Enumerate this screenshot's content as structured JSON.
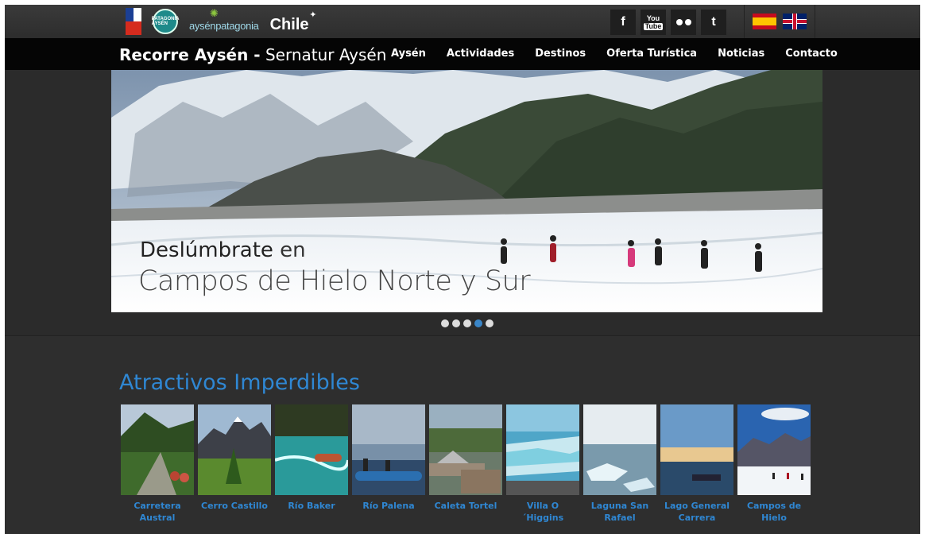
{
  "header": {
    "logos": {
      "gobierno": "",
      "patagonia_badge": "PATAGONIA AYSÉN",
      "aysen_patagonia": "aysénpatagonia",
      "chile": "Chile"
    },
    "social": {
      "facebook": "f",
      "youtube_top": "You",
      "youtube_bottom": "Tube",
      "twitter": "t"
    }
  },
  "nav": {
    "brand_bold": "Recorre Aysén -",
    "brand_light": " Sernatur Aysén",
    "items": [
      "Aysén",
      "Actividades",
      "Destinos",
      "Oferta Turística",
      "Noticias",
      "Contacto"
    ]
  },
  "hero": {
    "line1_bold": "Deslúmbrate",
    "line1_rest": " en",
    "line2": "Campos de Hielo Norte y Sur",
    "slides_total": 5,
    "active_slide": 4
  },
  "attractions": {
    "title": "Atractivos Imperdibles",
    "items": [
      {
        "label": "Carretera Austral"
      },
      {
        "label": "Cerro Castillo"
      },
      {
        "label": "Río Baker"
      },
      {
        "label": "Río Palena"
      },
      {
        "label": "Caleta Tortel"
      },
      {
        "label": "Villa O´Higgins"
      },
      {
        "label": "Laguna San Rafael"
      },
      {
        "label": "Lago General Carrera"
      },
      {
        "label": "Campos de Hielo"
      }
    ]
  }
}
